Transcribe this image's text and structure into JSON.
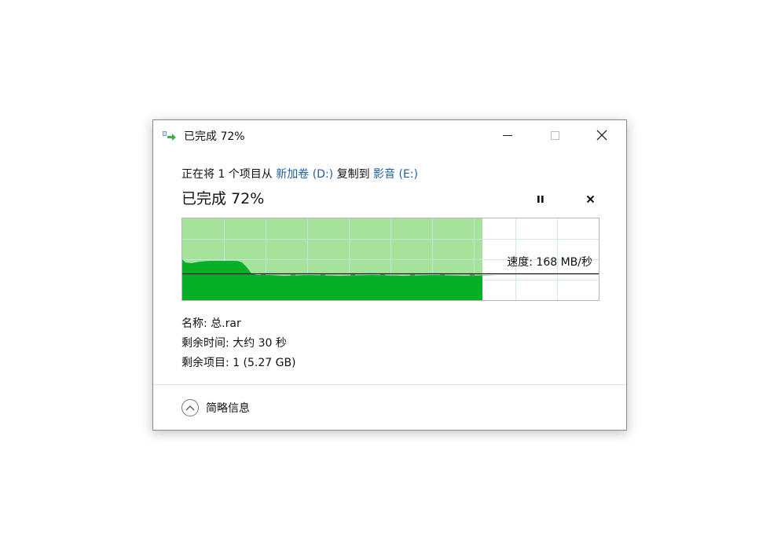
{
  "window": {
    "title": "已完成 72%"
  },
  "description": {
    "prefix": "正在将 1 个项目从",
    "source": "新加卷 (D:)",
    "middle": "复制到",
    "destination": "影音 (E:)"
  },
  "progress": {
    "heading": "已完成 72%",
    "percent": 72,
    "speed_label": "速度: 168 MB/秒"
  },
  "details": {
    "name": "名称: 总.rar",
    "time_remaining": "剩余时间: 大约 30 秒",
    "items_remaining": "剩余项目: 1 (5.27 GB)"
  },
  "footer": {
    "toggle_label": "简略信息"
  },
  "colors": {
    "graph_light_green": "#a6e39a",
    "graph_dark_green": "#06b025",
    "grid_line": "#c9e4ee",
    "link_blue": "#1f5ea8"
  },
  "icons": {
    "title": "copy-arrow-icon",
    "minimize": "minimize-icon",
    "maximize": "maximize-icon",
    "close": "close-icon",
    "pause": "pause-icon",
    "cancel": "cancel-icon",
    "toggle": "chevron-up-icon"
  }
}
